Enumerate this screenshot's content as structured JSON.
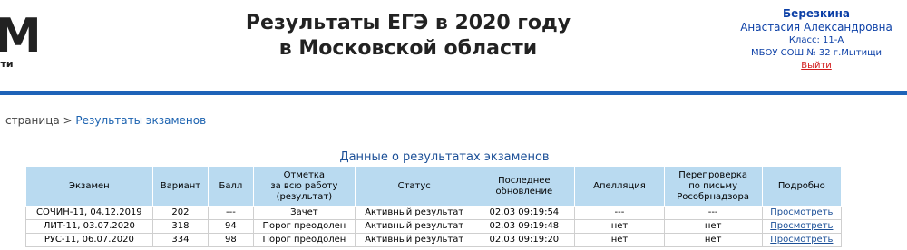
{
  "logo": {
    "mark": "M",
    "text": "сти"
  },
  "header": {
    "title_line1": "Результаты ЕГЭ в 2020 году",
    "title_line2": "в Московской области"
  },
  "user": {
    "surname": "Березкина",
    "name": "Анастасия Александровна",
    "class": "Класс: 11-А",
    "school": "МБОУ СОШ № 32 г.Мытищи",
    "logout": "Выйти"
  },
  "breadcrumb": {
    "prefix": "страница >",
    "current": "Результаты экзаменов"
  },
  "section_title": "Данные о результатах экзаменов",
  "table": {
    "headers": [
      "Экзамен",
      "Вариант",
      "Балл",
      "Отметка\nза всю работу\n(результат)",
      "Статус",
      "Последнее\nобновление",
      "Апелляция",
      "Перепроверка\nпо письму\nРособрнадзора",
      "Подробно"
    ],
    "rows": [
      {
        "exam": "СОЧИН-11, 04.12.2019",
        "variant": "202",
        "score": "---",
        "mark": "Зачет",
        "status": "Активный результат",
        "updated": "02.03 09:19:54",
        "appeal": "---",
        "recheck": "---",
        "details": "Просмотреть"
      },
      {
        "exam": "ЛИТ-11, 03.07.2020",
        "variant": "318",
        "score": "94",
        "mark": "Порог преодолен",
        "status": "Активный результат",
        "updated": "02.03 09:19:48",
        "appeal": "нет",
        "recheck": "нет",
        "details": "Просмотреть"
      },
      {
        "exam": "РУС-11, 06.07.2020",
        "variant": "334",
        "score": "98",
        "mark": "Порог преодолен",
        "status": "Активный результат",
        "updated": "02.03 09:19:20",
        "appeal": "нет",
        "recheck": "нет",
        "details": "Просмотреть"
      }
    ]
  }
}
